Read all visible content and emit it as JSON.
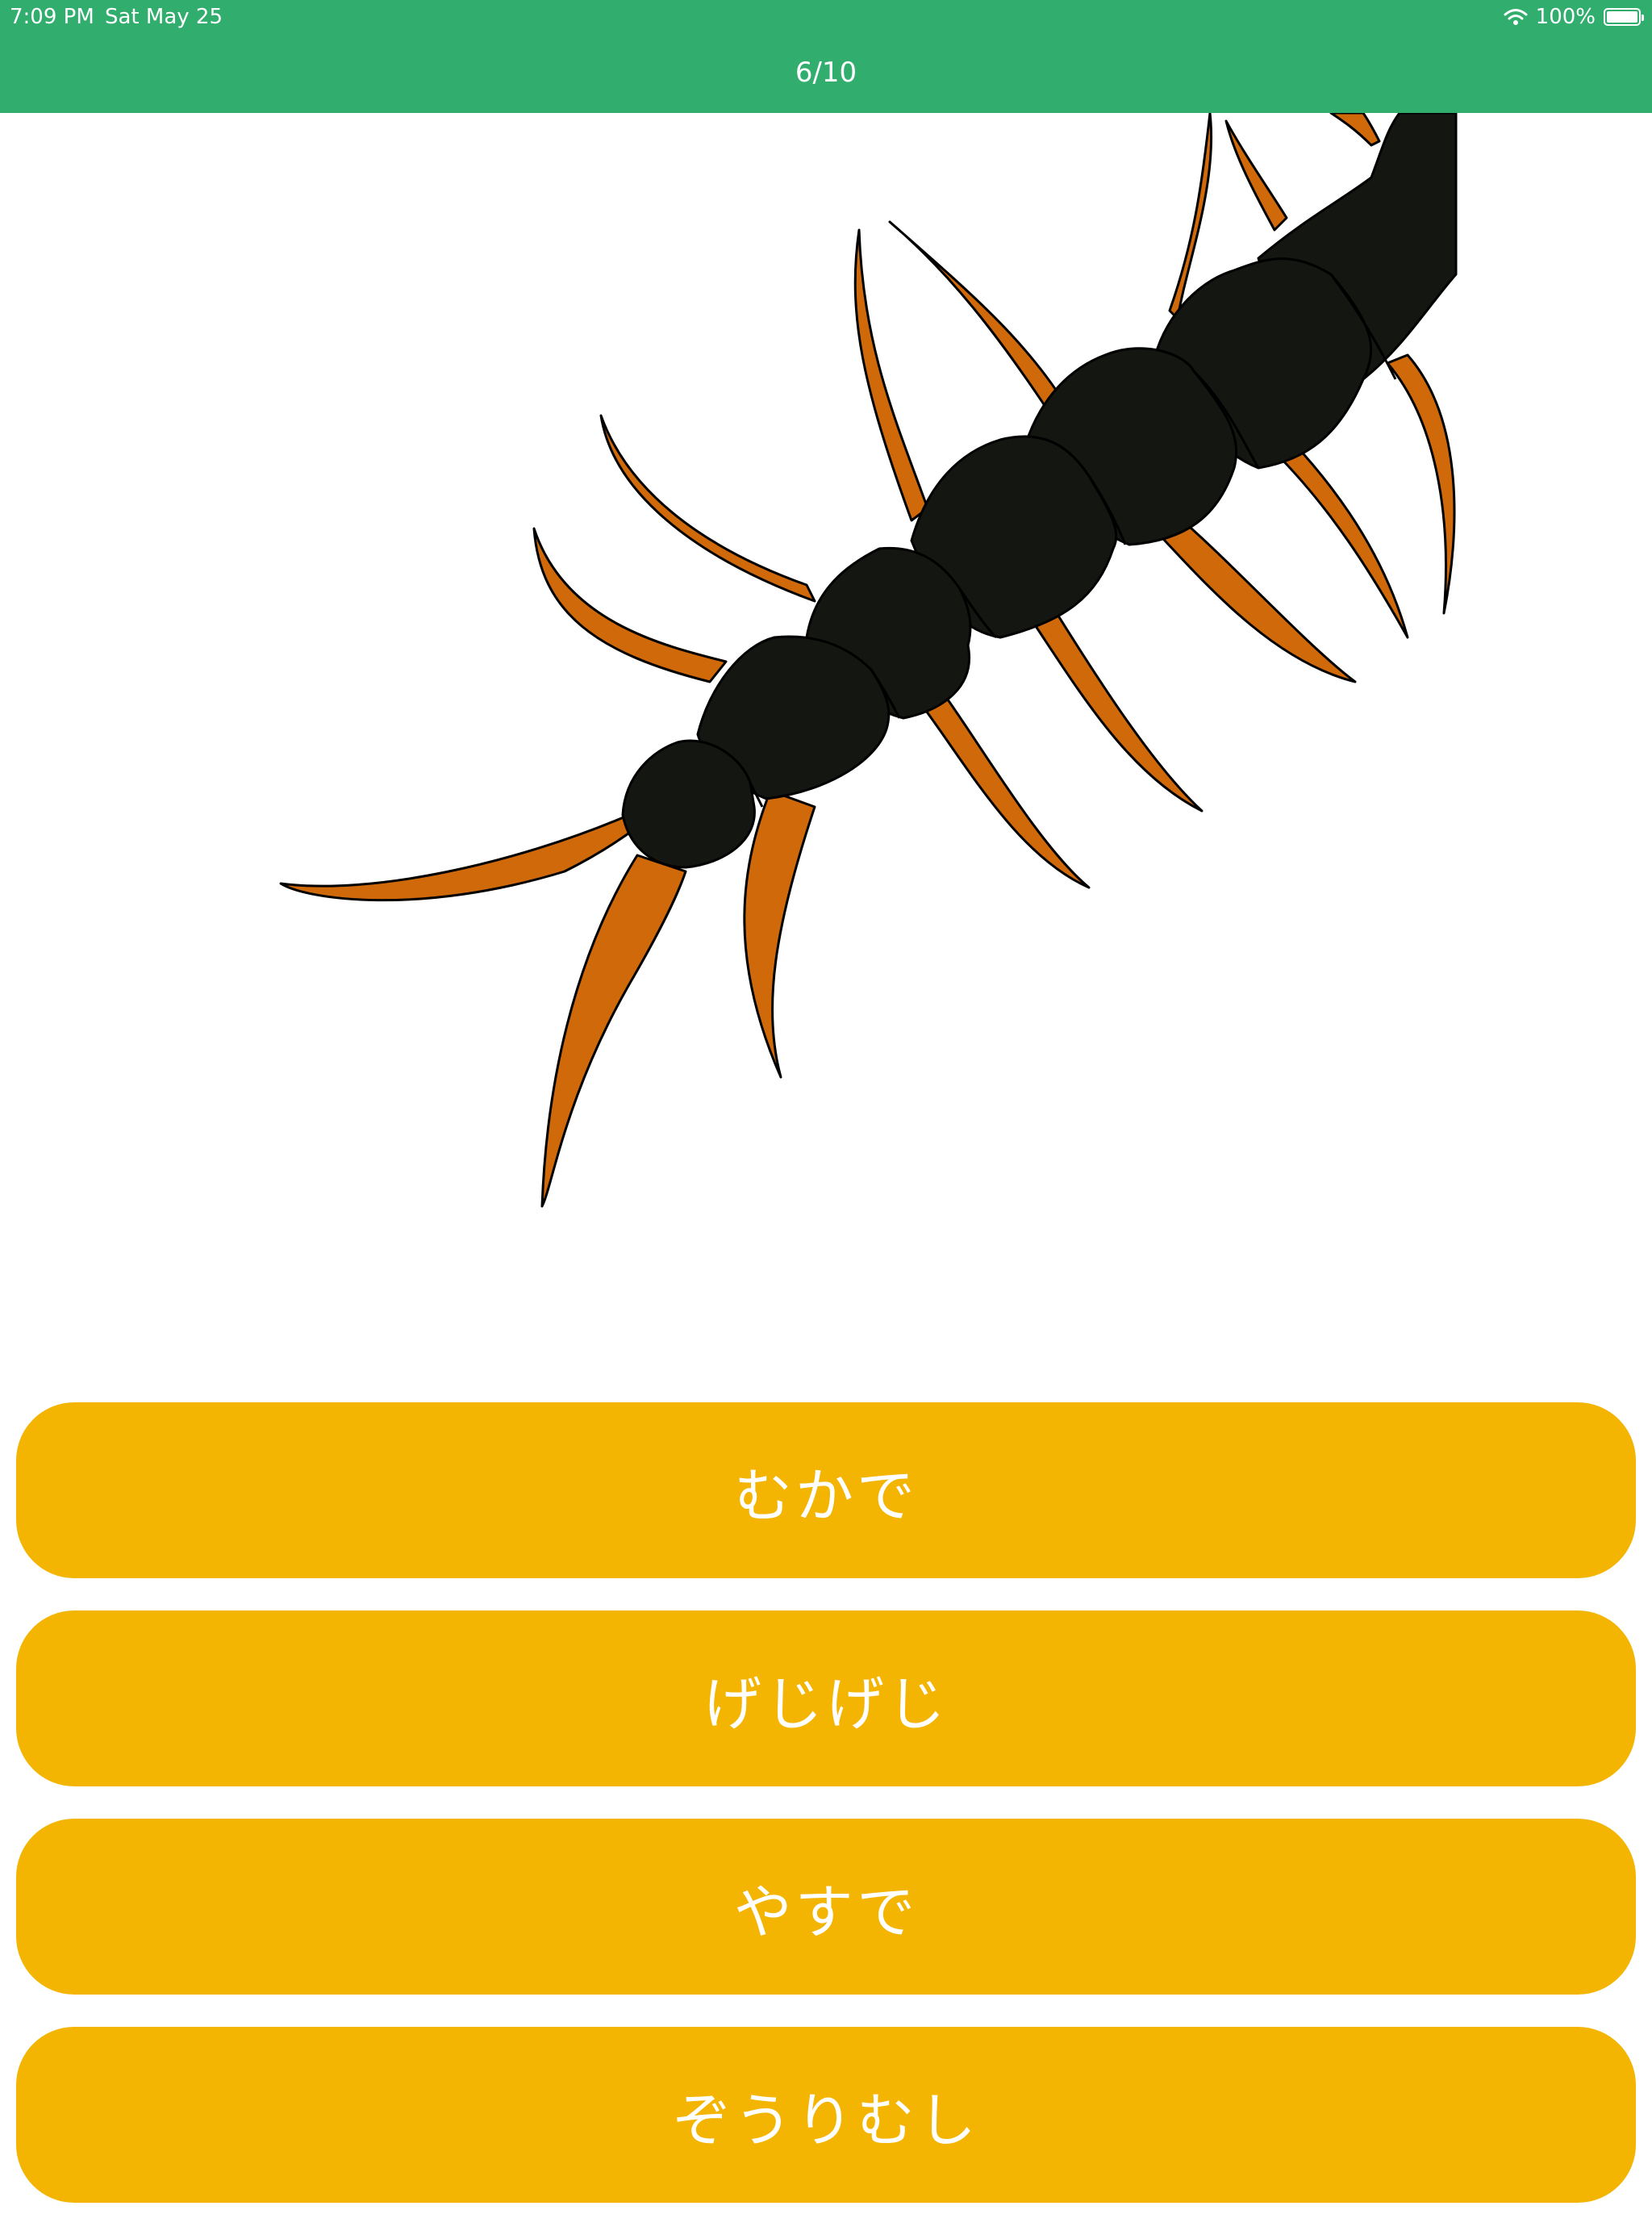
{
  "status_bar": {
    "time": "7:09 PM",
    "date": "Sat May 25",
    "battery_text": "100%",
    "battery_level": 1.0,
    "icons": [
      "wifi-icon",
      "battery-icon"
    ]
  },
  "header": {
    "progress": "6/10",
    "background_color": "#31ae6e"
  },
  "illustration": {
    "subject": "centipede",
    "body_color": "#141611",
    "leg_color": "#d0690a"
  },
  "answers": [
    {
      "label": "むかで"
    },
    {
      "label": "げじげじ"
    },
    {
      "label": "やすで"
    },
    {
      "label": "ぞうりむし"
    }
  ],
  "answer_color": "#f4b502"
}
